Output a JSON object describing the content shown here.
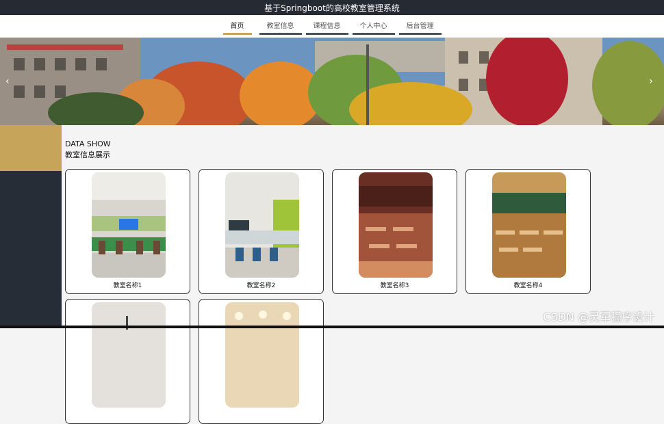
{
  "header": {
    "title": "基于Springboot的高校教室管理系统"
  },
  "nav": {
    "items": [
      {
        "label": "首页",
        "active": true
      },
      {
        "label": "教室信息",
        "active": false
      },
      {
        "label": "课程信息",
        "active": false
      },
      {
        "label": "个人中心",
        "active": false
      },
      {
        "label": "后台管理",
        "active": false
      }
    ]
  },
  "banner": {
    "prev_icon": "chevron-left-icon",
    "next_icon": "chevron-right-icon",
    "prev_glyph": "‹",
    "next_glyph": "›"
  },
  "section": {
    "title_en": "DATA SHOW",
    "title_cn": "教室信息展示"
  },
  "cards": [
    {
      "name": "教室名称1"
    },
    {
      "name": "教室名称2"
    },
    {
      "name": "教室名称3"
    },
    {
      "name": "教室名称4"
    },
    {
      "name": ""
    },
    {
      "name": ""
    }
  ],
  "watermark": {
    "text": "CSDN @灵军程序设计"
  },
  "colors": {
    "accent_gold": "#c6a45a",
    "dark": "#252a33"
  }
}
